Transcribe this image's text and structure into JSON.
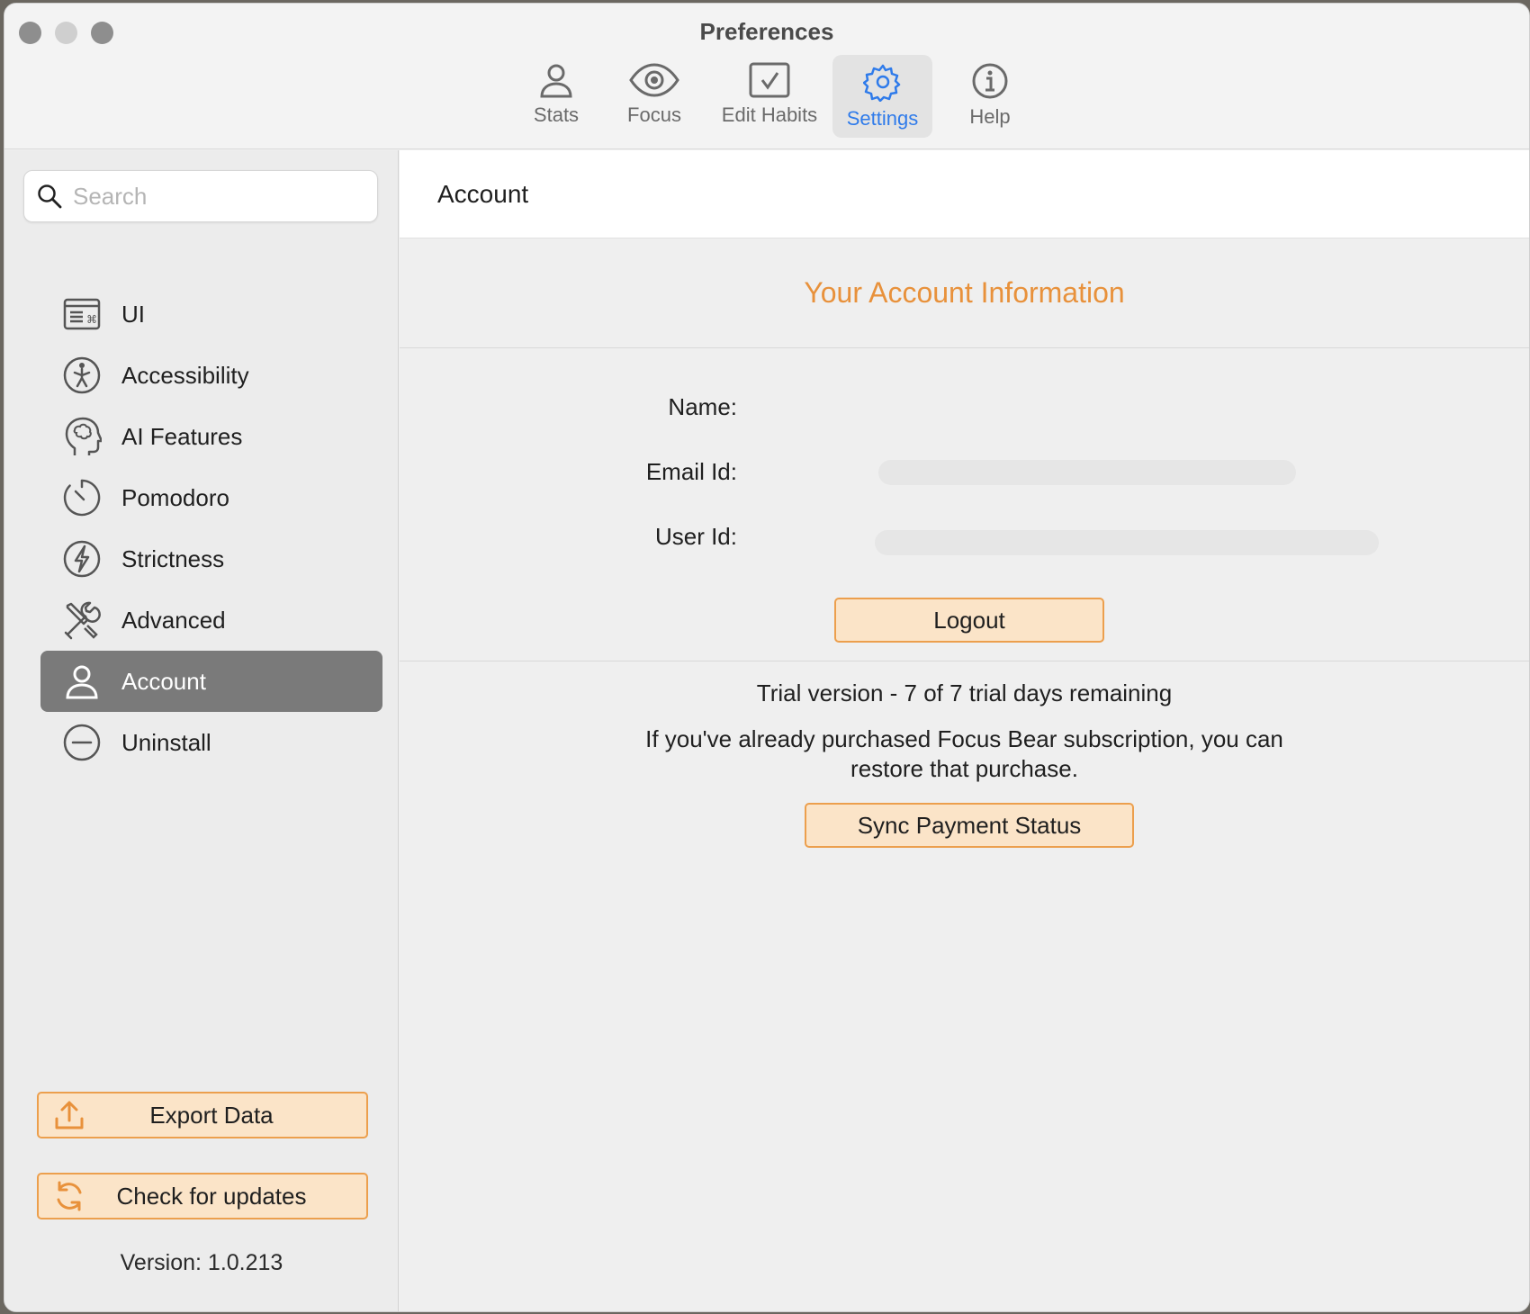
{
  "window": {
    "title": "Preferences"
  },
  "toolbar": {
    "items": [
      {
        "label": "Stats",
        "icon": "person-icon",
        "active": false
      },
      {
        "label": "Focus",
        "icon": "eye-icon",
        "active": false
      },
      {
        "label": "Edit Habits",
        "icon": "checkbox-icon",
        "active": false
      },
      {
        "label": "Settings",
        "icon": "gear-icon",
        "active": true
      },
      {
        "label": "Help",
        "icon": "info-icon",
        "active": false
      }
    ],
    "active_color": "#2f7bea"
  },
  "sidebar": {
    "search": {
      "placeholder": "Search",
      "value": ""
    },
    "items": [
      {
        "label": "UI",
        "icon": "keyboard-window-icon"
      },
      {
        "label": "Accessibility",
        "icon": "accessibility-icon"
      },
      {
        "label": "AI Features",
        "icon": "brain-head-icon"
      },
      {
        "label": "Pomodoro",
        "icon": "timer-icon"
      },
      {
        "label": "Strictness",
        "icon": "bolt-icon"
      },
      {
        "label": "Advanced",
        "icon": "tools-icon"
      },
      {
        "label": "Account",
        "icon": "person-icon",
        "active": true
      },
      {
        "label": "Uninstall",
        "icon": "minus-circle-icon"
      }
    ],
    "export_label": "Export Data",
    "updates_label": "Check for updates",
    "version": "Version: 1.0.213"
  },
  "main": {
    "header": "Account",
    "section_title": "Your Account Information",
    "fields": {
      "name_label": "Name:",
      "email_label": "Email Id:",
      "userid_label": "User Id:"
    },
    "logout_label": "Logout",
    "trial_text": "Trial version - 7 of 7 trial days remaining",
    "restore_line1": "If you've already purchased Focus Bear subscription, you can",
    "restore_line2": "restore that purchase.",
    "sync_label": "Sync Payment Status"
  },
  "colors": {
    "accent_orange": "#e8913b",
    "button_fill": "#fbe4c8",
    "button_border": "#ec9f4d"
  }
}
